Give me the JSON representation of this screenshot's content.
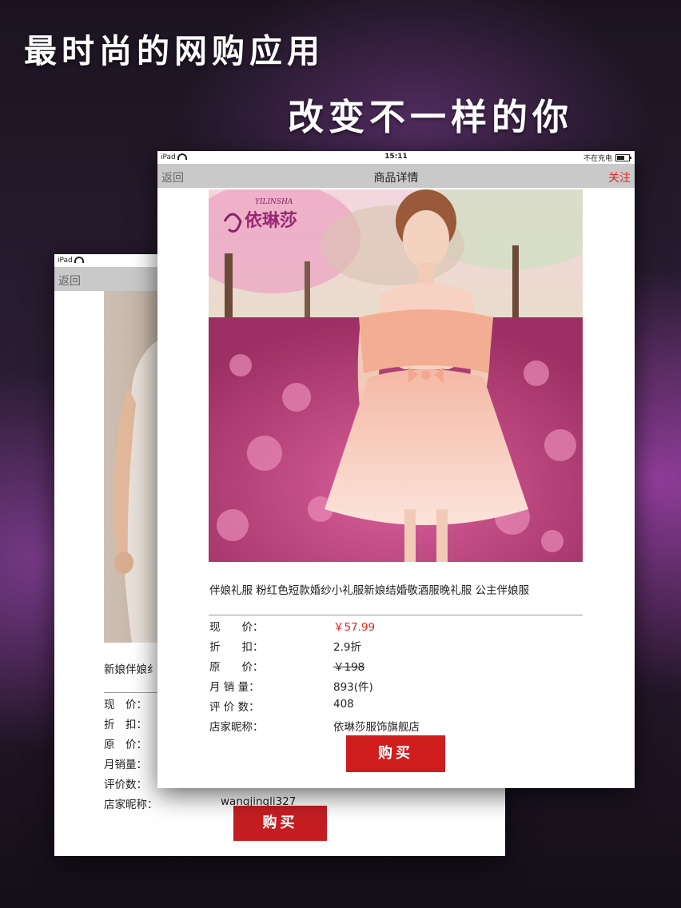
{
  "headline": {
    "line1": "最时尚的网购应用",
    "line2": "改变不一样的你"
  },
  "back_screen": {
    "status": {
      "device": "iPad"
    },
    "nav": {
      "back_label": "返回"
    },
    "product_title": "新娘伴娘纟",
    "details": [
      {
        "label": "现　价：",
        "value": ""
      },
      {
        "label": "折　扣：",
        "value": ""
      },
      {
        "label": "原　价：",
        "value": ""
      },
      {
        "label": "月销量：",
        "value": ""
      },
      {
        "label": "评价数：",
        "value": ""
      },
      {
        "label": "店家昵称：",
        "value": "wangjingli327"
      }
    ],
    "buy_label": "购买"
  },
  "front_screen": {
    "status": {
      "device": "iPad",
      "time": "15:11",
      "charging": "不在充电"
    },
    "nav": {
      "back_label": "返回",
      "title": "商品详情",
      "follow_label": "关注"
    },
    "brand": {
      "name": "依琳莎",
      "latin": "YILINSHA"
    },
    "product_title": "伴娘礼服 粉红色短款婚纱小礼服新娘结婚敬酒服晚礼服 公主伴娘服",
    "details": {
      "current_price": {
        "label": "现　　价：",
        "value": "￥57.99"
      },
      "discount": {
        "label": "折　　扣：",
        "value": "2.9折"
      },
      "original_price": {
        "label": "原　　价：",
        "value": "￥198"
      },
      "monthly_sales": {
        "label": "月 销 量：",
        "value": "893(件)"
      },
      "reviews": {
        "label": "评 价 数：",
        "value": "408"
      },
      "shop_name": {
        "label": "店家昵称：",
        "value": "依琳莎服饰旗舰店"
      }
    },
    "buy_label": "购买"
  },
  "colors": {
    "accent_red": "#e8231f",
    "buy_button": "#cf1d1d",
    "nav_bar": "#c9c9c9"
  }
}
